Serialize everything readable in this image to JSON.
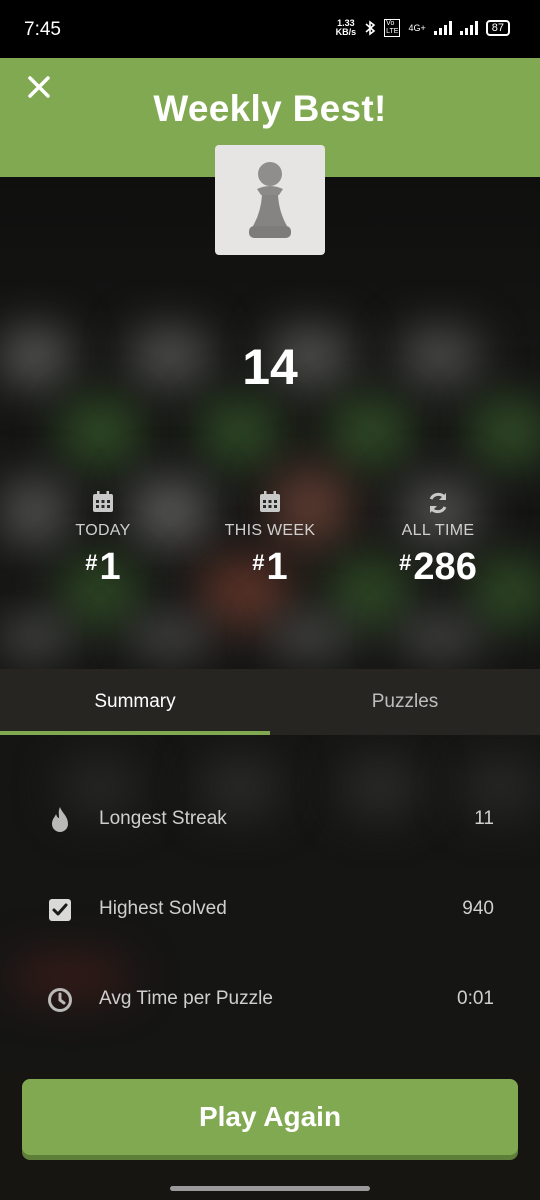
{
  "status_bar": {
    "time": "7:45",
    "speed_value": "1.33",
    "speed_unit": "KB/s",
    "network": "4G+",
    "battery": "87"
  },
  "header": {
    "title": "Weekly Best!",
    "close_icon": "close-icon"
  },
  "score": "14",
  "ranks": [
    {
      "label": "TODAY",
      "value": "1",
      "icon": "calendar-icon"
    },
    {
      "label": "THIS WEEK",
      "value": "1",
      "icon": "calendar-icon"
    },
    {
      "label": "ALL TIME",
      "value": "286",
      "icon": "refresh-icon"
    }
  ],
  "tabs": [
    {
      "label": "Summary",
      "active": true
    },
    {
      "label": "Puzzles",
      "active": false
    }
  ],
  "stats": [
    {
      "label": "Longest Streak",
      "value": "11",
      "icon": "flame-icon"
    },
    {
      "label": "Highest Solved",
      "value": "940",
      "icon": "checkbox-icon"
    },
    {
      "label": "Avg Time per Puzzle",
      "value": "0:01",
      "icon": "clock-icon"
    }
  ],
  "play_button": "Play Again",
  "colors": {
    "accent": "#81a951",
    "background": "#161512"
  }
}
